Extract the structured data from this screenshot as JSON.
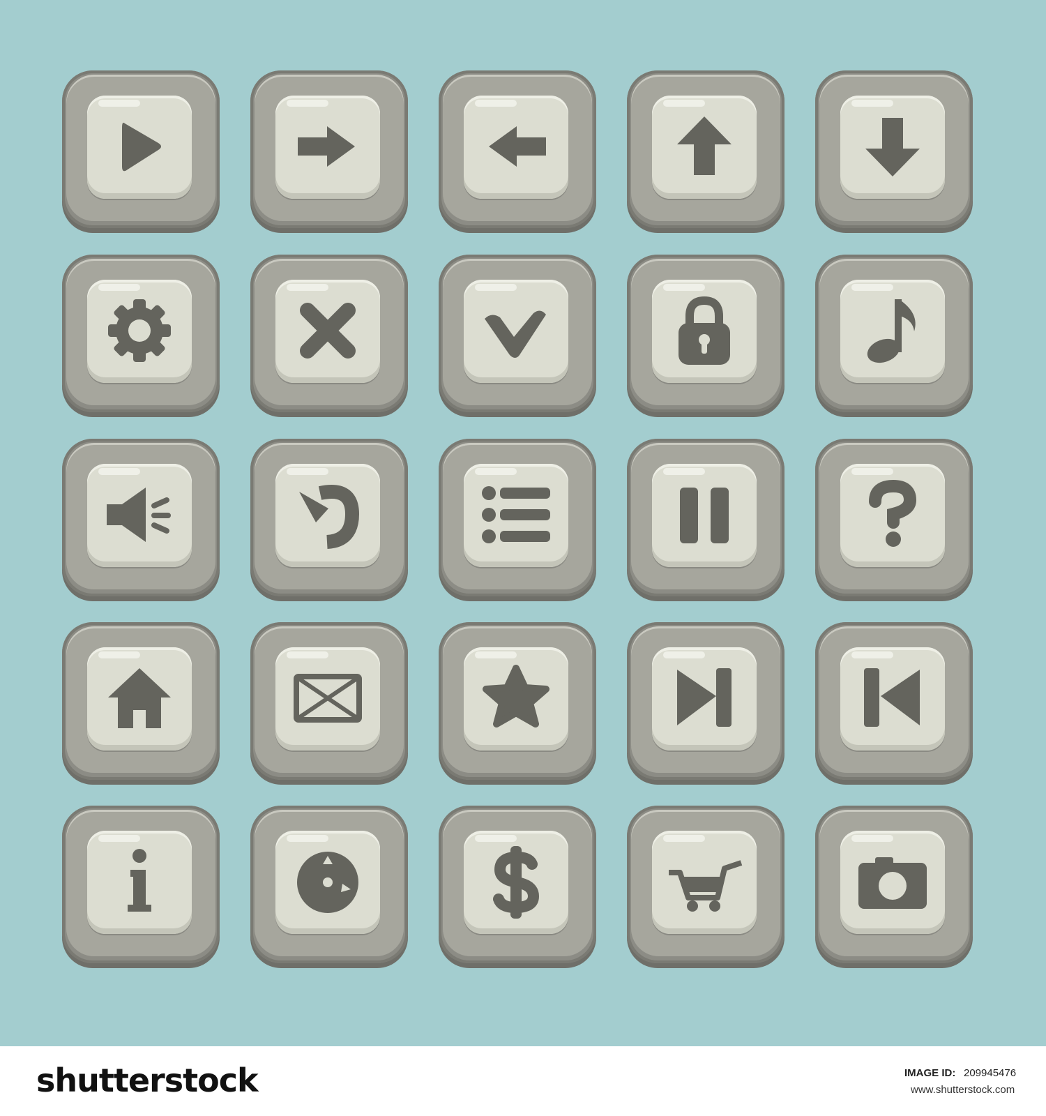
{
  "background_color": "#a3cdcf",
  "tile_color": "#a6a69d",
  "icon_color": "#64645d",
  "buttons": [
    {
      "icon": "play-icon"
    },
    {
      "icon": "arrow-right-icon"
    },
    {
      "icon": "arrow-left-icon"
    },
    {
      "icon": "arrow-up-icon"
    },
    {
      "icon": "arrow-down-icon"
    },
    {
      "icon": "gear-icon"
    },
    {
      "icon": "close-icon"
    },
    {
      "icon": "checkmark-icon"
    },
    {
      "icon": "lock-icon"
    },
    {
      "icon": "music-note-icon"
    },
    {
      "icon": "speaker-icon"
    },
    {
      "icon": "restart-icon"
    },
    {
      "icon": "menu-list-icon"
    },
    {
      "icon": "pause-icon"
    },
    {
      "icon": "question-icon"
    },
    {
      "icon": "home-icon"
    },
    {
      "icon": "mail-icon"
    },
    {
      "icon": "star-icon"
    },
    {
      "icon": "skip-forward-icon"
    },
    {
      "icon": "skip-back-icon"
    },
    {
      "icon": "info-icon"
    },
    {
      "icon": "clock-icon"
    },
    {
      "icon": "dollar-icon"
    },
    {
      "icon": "cart-icon"
    },
    {
      "icon": "camera-icon"
    }
  ],
  "footer": {
    "logo": "shutterstock",
    "image_id_label": "IMAGE ID:",
    "image_id": "209945476",
    "site": "www.shutterstock.com"
  }
}
